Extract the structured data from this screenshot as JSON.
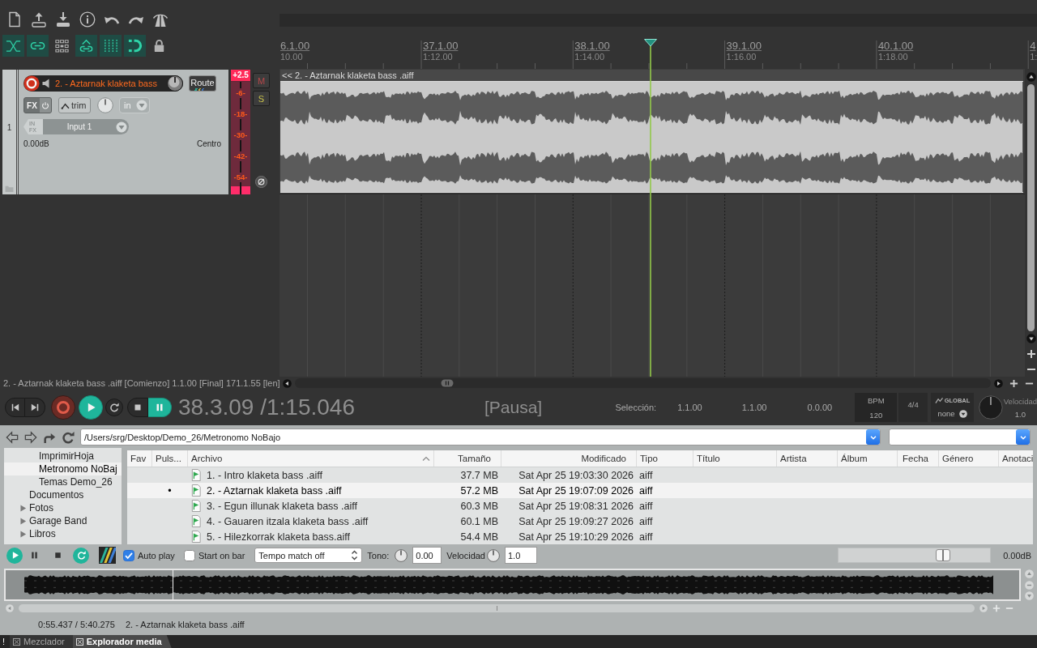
{
  "toolbar": {
    "toggles": [
      {
        "on": true
      },
      {
        "on": true
      },
      {
        "on": false
      },
      {
        "on": true
      },
      {
        "on": true
      },
      {
        "on": true
      },
      {
        "on": false
      }
    ]
  },
  "track": {
    "number": "1",
    "armed": true,
    "name": "2. - Aztarnak klaketa bass",
    "route": "Route",
    "fx": "FX",
    "trim": "trim",
    "monitor": "in",
    "input_fx": [
      "IN",
      "FX"
    ],
    "input": "Input 1",
    "volume": "0.00dB",
    "pan": "Centro",
    "meter": {
      "peak": "+2.5",
      "scale": [
        "-6-",
        "-18-",
        "-30-",
        "-42-",
        "-54-"
      ],
      "channels": [
        {
          "level": 0.07
        },
        {
          "level": 0.07
        }
      ]
    },
    "mute": {
      "label": "M",
      "on": false
    },
    "solo": {
      "label": "S",
      "on": false
    }
  },
  "arrange": {
    "ruler": [
      {
        "bar": "6.1.00",
        "time": "10.00"
      },
      {
        "bar": "37.1.00",
        "time": "1:12.00"
      },
      {
        "bar": "38.1.00",
        "time": "1:14.00"
      },
      {
        "bar": "39.1.00",
        "time": "1:16.00"
      },
      {
        "bar": "40.1.00",
        "time": "1:18.00"
      },
      {
        "bar": "4",
        "time": "1:"
      }
    ],
    "playhead": {
      "level": 0.498
    },
    "item": {
      "title": "<< 2. - Aztarnak klaketa bass .aiff"
    }
  },
  "status": "2. - Aztarnak klaketa bass .aiff [Comienzo] 1.1.00 [Final] 171.1.55 [len]",
  "transport": {
    "buttons": [
      {
        "on": false
      },
      {
        "on": false
      },
      {
        "on": false
      },
      {
        "on": true
      },
      {
        "on": false
      },
      {
        "on": false
      },
      {
        "on": true
      }
    ],
    "position": "38.3.09 /1:15.046",
    "state": "[Pausa]",
    "selection": {
      "label": "Selección:",
      "values": [
        "1.1.00",
        "1.1.00",
        "0.0.00"
      ]
    },
    "tempo": {
      "label": "BPM",
      "value": "120"
    },
    "signature": "4/4",
    "timebase": {
      "label": "GLOBAL",
      "value": "none"
    },
    "rate": {
      "label": "Velocidad",
      "value": "1.0"
    }
  },
  "explorer": {
    "path": "/Users/srg/Desktop/Demo_26/Metronomo NoBajo",
    "tree": [
      {
        "children": [
          {
            "label": "ImprimirHoja",
            "selected": false
          },
          {
            "label": "Metronomo NoBaj",
            "selected": true
          },
          {
            "label": "Temas Demo_26",
            "selected": false
          }
        ]
      },
      {
        "label": "Documentos",
        "selected": false
      },
      {
        "label": "Fotos",
        "selected": false,
        "expanded": false
      },
      {
        "label": "Garage Band",
        "selected": false,
        "expanded": false
      },
      {
        "label": "Libros",
        "selected": false,
        "expanded": false
      }
    ],
    "columns": [
      {
        "label": "Fav",
        "sorted": false
      },
      {
        "label": "Puls...",
        "sorted": false
      },
      {
        "label": "Archivo",
        "sorted": true
      },
      {
        "label": "Tamaño",
        "sorted": false
      },
      {
        "label": "Modificado",
        "sorted": false
      },
      {
        "label": "Tipo",
        "sorted": false
      },
      {
        "label": "Título",
        "sorted": false
      },
      {
        "label": "Artista",
        "sorted": false
      },
      {
        "label": "Álbum",
        "sorted": false
      },
      {
        "label": "Fecha",
        "sorted": false
      },
      {
        "label": "Género",
        "sorted": false
      },
      {
        "label": "Anotaci",
        "sorted": false
      }
    ],
    "rows": [
      {
        "selected": false,
        "file": "1. - Intro klaketa bass .aiff",
        "size": "37.7 MB",
        "modified": "Sat Apr 25 19:03:30 2026",
        "type": "aiff"
      },
      {
        "selected": true,
        "puls": "•",
        "file": "2. - Aztarnak klaketa bass .aiff",
        "size": "57.2 MB",
        "modified": "Sat Apr 25 19:07:09 2026",
        "type": "aiff"
      },
      {
        "selected": false,
        "file": "3. - Egun illunak klaketa bass .aiff",
        "size": "60.3 MB",
        "modified": "Sat Apr 25 19:08:31 2026",
        "type": "aiff"
      },
      {
        "selected": false,
        "file": "4. - Gauaren itzala klaketa bass .aiff",
        "size": "60.1 MB",
        "modified": "Sat Apr 25 19:09:27 2026",
        "type": "aiff"
      },
      {
        "selected": false,
        "file": "5. - Hilezkorrak klaketa bass.aiff",
        "size": "54.4 MB",
        "modified": "Sat Apr 25 19:10:29 2026",
        "type": "aiff"
      }
    ],
    "preview": {
      "buttons": [
        {
          "on": true
        },
        {
          "on": false
        },
        {
          "on": false
        },
        {
          "on": true
        }
      ],
      "autoplay": {
        "label": "Auto play",
        "checked": true
      },
      "start_on_bar": {
        "label": "Start on bar",
        "checked": false
      },
      "tempo_match": "Tempo match off",
      "pitch": {
        "label": "Tono:",
        "value": "0.00"
      },
      "rate": {
        "label": "Velocidad",
        "value": "1.0"
      },
      "volume": {
        "level": 0.69,
        "reading": "0.00dB"
      }
    },
    "waveform": {
      "playhead": {
        "level": 0.165
      }
    },
    "status": {
      "time": "0:55.437 / 5:40.275",
      "file": "2. - Aztarnak klaketa bass .aiff"
    }
  },
  "tabs": {
    "flag": "!",
    "items": [
      {
        "label": "Mezclador",
        "selected": false
      },
      {
        "label": "Explorador media",
        "selected": true
      }
    ]
  }
}
